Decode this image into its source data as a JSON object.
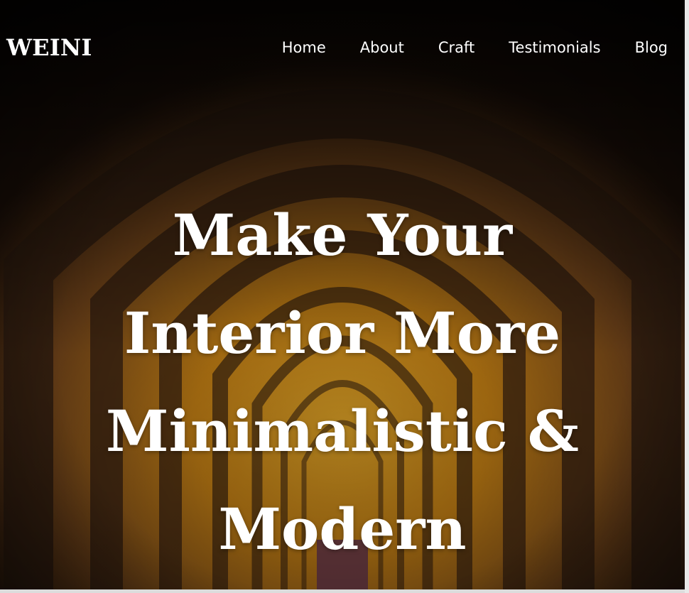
{
  "brand": {
    "logo_text": "WEINI"
  },
  "nav": {
    "items": [
      {
        "label": "Home"
      },
      {
        "label": "About"
      },
      {
        "label": "Craft"
      },
      {
        "label": "Testimonials"
      },
      {
        "label": "Blog"
      }
    ]
  },
  "hero": {
    "headline_lines": [
      "Make Your",
      "Interior More",
      "Minimalistic &",
      "Modern"
    ],
    "background_image": "arched-corridor-photo"
  },
  "colors": {
    "text": "#ffffff",
    "overlay": "#000000",
    "warm_light": "#e7a312",
    "stone": "#7a4f2e"
  }
}
